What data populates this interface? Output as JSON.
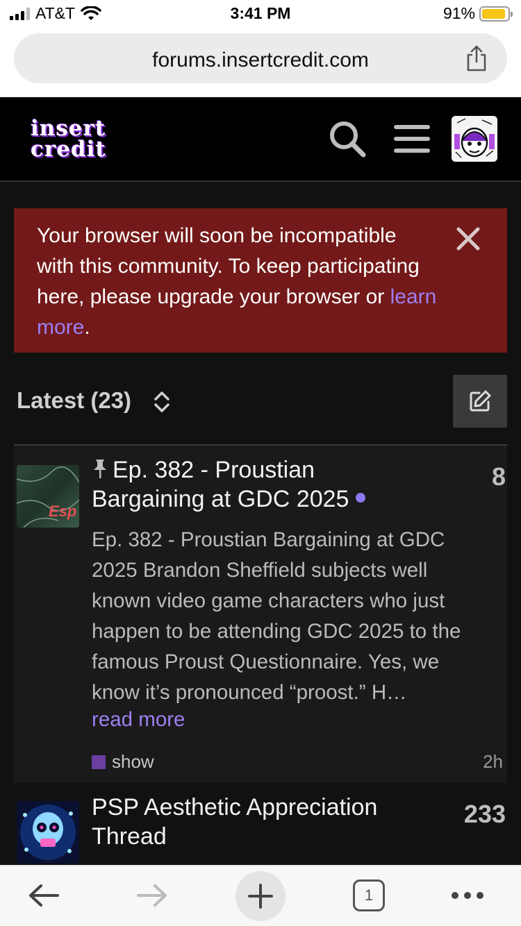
{
  "status_bar": {
    "carrier": "AT&T",
    "time": "3:41 PM",
    "battery": "91%",
    "battery_level": 0.91
  },
  "browser": {
    "url": "forums.insertcredit.com",
    "tab_count": "1"
  },
  "site": {
    "logo_line1": "insert",
    "logo_line2": "credit"
  },
  "alert": {
    "message": "Your browser will soon be incompatible with this community. To keep participating here, please upgrade your browser or",
    "link": "learn more",
    "after_link": "."
  },
  "list": {
    "heading": "Latest (23)"
  },
  "topics": [
    {
      "title": "Ep. 382 - Proustian Bargaining at GDC 2025",
      "replies": "8",
      "excerpt": "Ep. 382 - Proustian Bargaining at GDC 2025 Brandon Sheffield subjects well known video game characters who just happen to be attending GDC 2025 to the famous Proust Questionnaire. Yes, we know it’s pronounced “proost.” H…",
      "read_more": "read more",
      "category": "show",
      "category_color": "#6a3fa0",
      "age": "2h",
      "avatar_text": "Esp"
    },
    {
      "title": "PSP Aesthetic Appreciation Thread",
      "replies": "233"
    }
  ],
  "colors": {
    "alert_bg": "#731919",
    "link": "#9d7ff0",
    "unread": "#8f78ef"
  }
}
